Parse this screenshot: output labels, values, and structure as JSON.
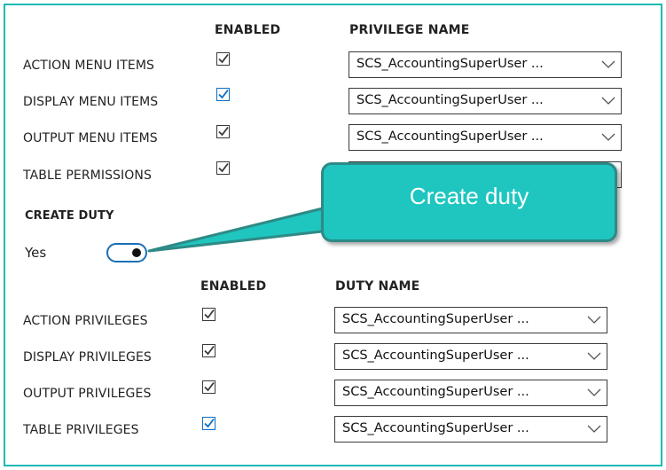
{
  "top_section": {
    "enabled_header": "ENABLED",
    "name_header": "PRIVILEGE NAME",
    "rows": [
      {
        "label": "ACTION MENU ITEMS",
        "checked": true,
        "value": "SCS_AccountingSuperUser ..."
      },
      {
        "label": "DISPLAY MENU ITEMS",
        "checked": true,
        "value": "SCS_AccountingSuperUser ..."
      },
      {
        "label": "OUTPUT MENU ITEMS",
        "checked": true,
        "value": "SCS_AccountingSuperUser ..."
      },
      {
        "label": "TABLE PERMISSIONS",
        "checked": true,
        "value": ""
      }
    ]
  },
  "create_duty": {
    "label": "CREATE DUTY",
    "toggle_text": "Yes",
    "toggle_on": true
  },
  "callout": {
    "text": "Create duty",
    "bg_color": "#1fc6c0"
  },
  "bottom_section": {
    "enabled_header": "ENABLED",
    "name_header": "DUTY NAME",
    "rows": [
      {
        "label": "ACTION PRIVILEGES",
        "checked": true,
        "value": "SCS_AccountingSuperUser ..."
      },
      {
        "label": "DISPLAY PRIVILEGES",
        "checked": true,
        "value": "SCS_AccountingSuperUser ..."
      },
      {
        "label": "OUTPUT PRIVILEGES",
        "checked": true,
        "value": "SCS_AccountingSuperUser ..."
      },
      {
        "label": "TABLE PRIVILEGES",
        "checked": true,
        "value": "SCS_AccountingSuperUser ..."
      }
    ]
  },
  "colors": {
    "frame_border": "#1dbab4",
    "checkbox_blue": "#0a6fc4",
    "toggle_border": "#1b6fb5"
  }
}
